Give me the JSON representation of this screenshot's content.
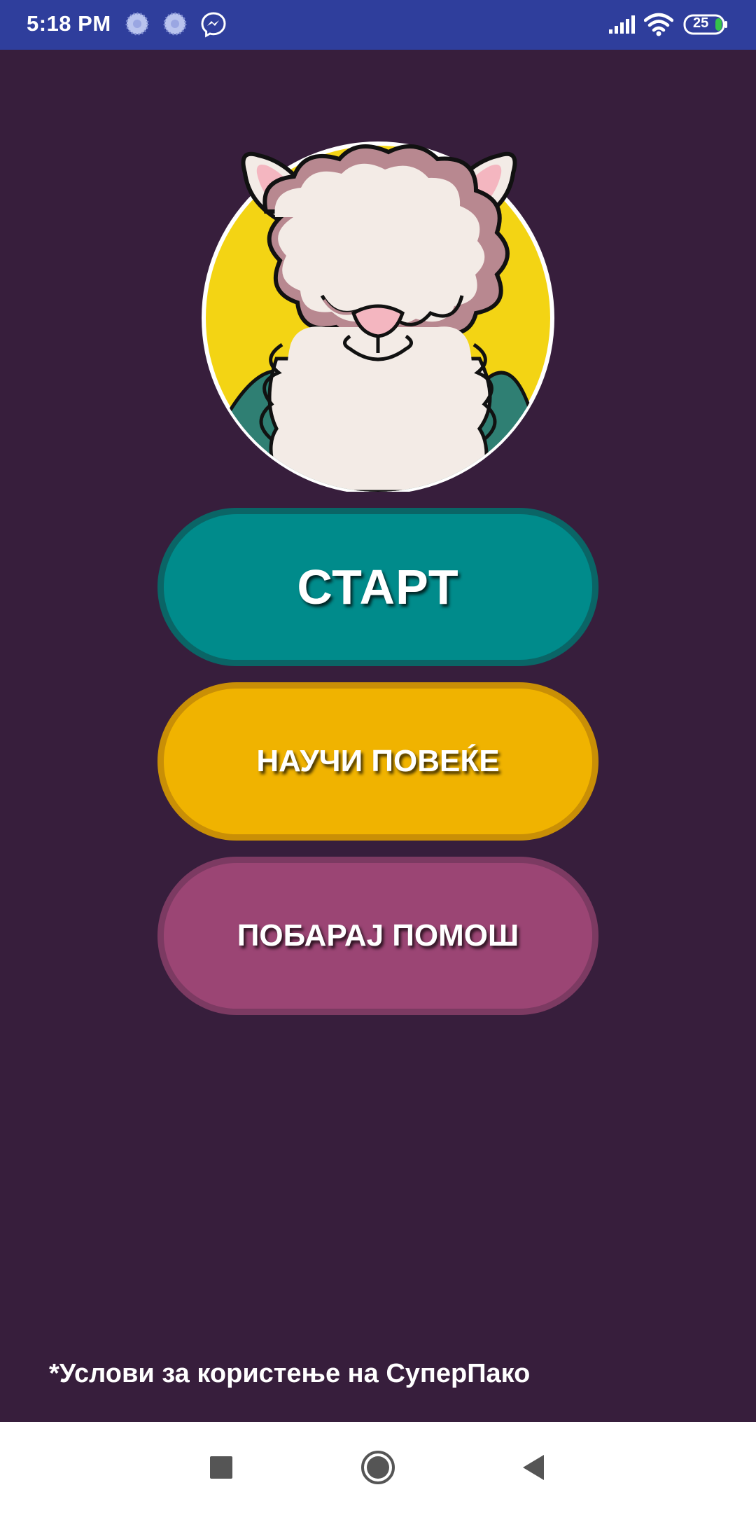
{
  "status_bar": {
    "time": "5:18 PM",
    "battery_level": "25",
    "icons": [
      "sync-icon",
      "sync-icon",
      "messenger-icon",
      "signal-icon",
      "wifi-icon",
      "battery-icon"
    ]
  },
  "avatar": {
    "icon": "alpaca-avatar",
    "colors": {
      "background": "#f3d414",
      "wool": "#f3ebe6",
      "wool_shadow": "#b88890",
      "ears": "#f4b6c0",
      "scarf": "#2f7f73"
    }
  },
  "buttons": {
    "start": "СТАРТ",
    "learn_more": "НАУЧИ ПОВЕЌЕ",
    "ask_help": "ПОБАРАЈ ПОМОШ"
  },
  "footer": {
    "terms": "*Услови за користење на СуперПако"
  },
  "colors": {
    "background": "#371e3c",
    "status_bar": "#2f3e9c",
    "start_button": "#008b8b",
    "learn_button": "#f0b300",
    "help_button": "#9b4574"
  },
  "nav_bar": {
    "icons": [
      "recent-apps-icon",
      "home-icon",
      "back-icon"
    ]
  }
}
